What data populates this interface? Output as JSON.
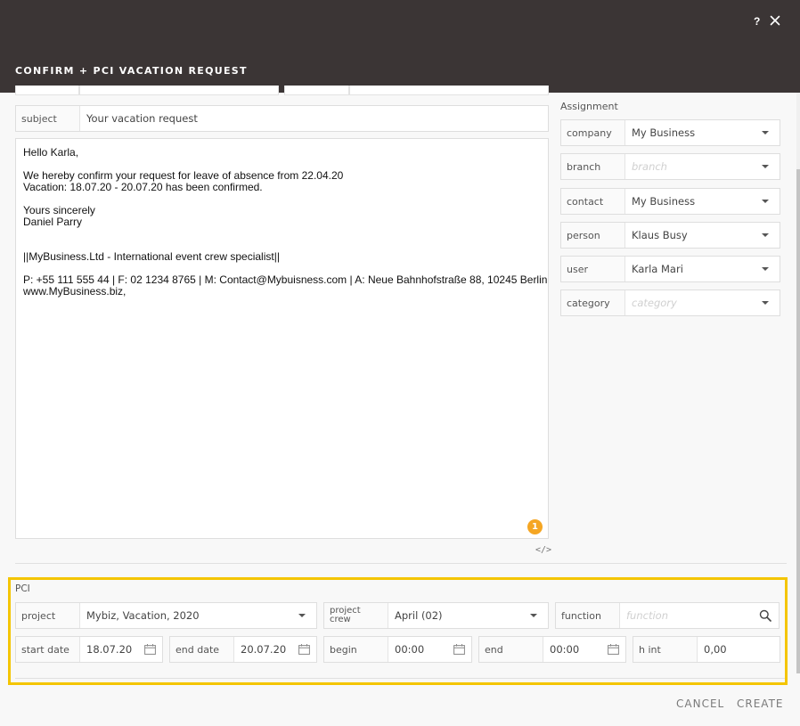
{
  "header": {
    "title": "CONFIRM + PCI VACATION REQUEST",
    "help_label": "?"
  },
  "mail": {
    "subject_label": "subject",
    "subject_value": "Your vacation request",
    "body_lines": [
      "Hello Karla,",
      "",
      "We hereby confirm your request for leave of absence from 22.04.20",
      "Vacation: 18.07.20 - 20.07.20 has been confirmed.",
      "",
      "Yours sincerely",
      "Daniel Parry",
      "",
      "",
      "||MyBusiness.Ltd - International event crew specialist||",
      "",
      "P: +55 111 555 44 | F: 02 1234 8765 | M: Contact@Mybuisness.com | A: Neue Bahnhofstraße 88, 10245 Berlin",
      "www.MyBusiness.biz,"
    ],
    "badge_count": "1",
    "source_toggle": "</>"
  },
  "assignment": {
    "title": "Assignment",
    "fields": [
      {
        "label": "company",
        "value": "My Business",
        "placeholder": false
      },
      {
        "label": "branch",
        "value": "branch",
        "placeholder": true
      },
      {
        "label": "contact",
        "value": "My Business",
        "placeholder": false
      },
      {
        "label": "person",
        "value": "Klaus Busy",
        "placeholder": false
      },
      {
        "label": "user",
        "value": "Karla Mari",
        "placeholder": false
      },
      {
        "label": "category",
        "value": "category",
        "placeholder": true
      }
    ]
  },
  "pci": {
    "title": "PCI",
    "project_label": "project",
    "project_value": "Mybiz, Vacation, 2020",
    "project_crew_label_1": "project",
    "project_crew_label_2": "crew",
    "project_crew_value": "April (02)",
    "function_label": "function",
    "function_placeholder": "function",
    "start_date_label": "start date",
    "start_date_value": "18.07.20",
    "end_date_label": "end date",
    "end_date_value": "20.07.20",
    "begin_label": "begin",
    "begin_value": "00:00",
    "end_label": "end",
    "end_value": "00:00",
    "h_int_label": "h int",
    "h_int_value": "0,00"
  },
  "footer": {
    "cancel_label": "CANCEL",
    "create_label": "CREATE"
  },
  "colors": {
    "header_bg": "#3b3535",
    "highlight": "#f4c500",
    "badge": "#f5a623"
  }
}
